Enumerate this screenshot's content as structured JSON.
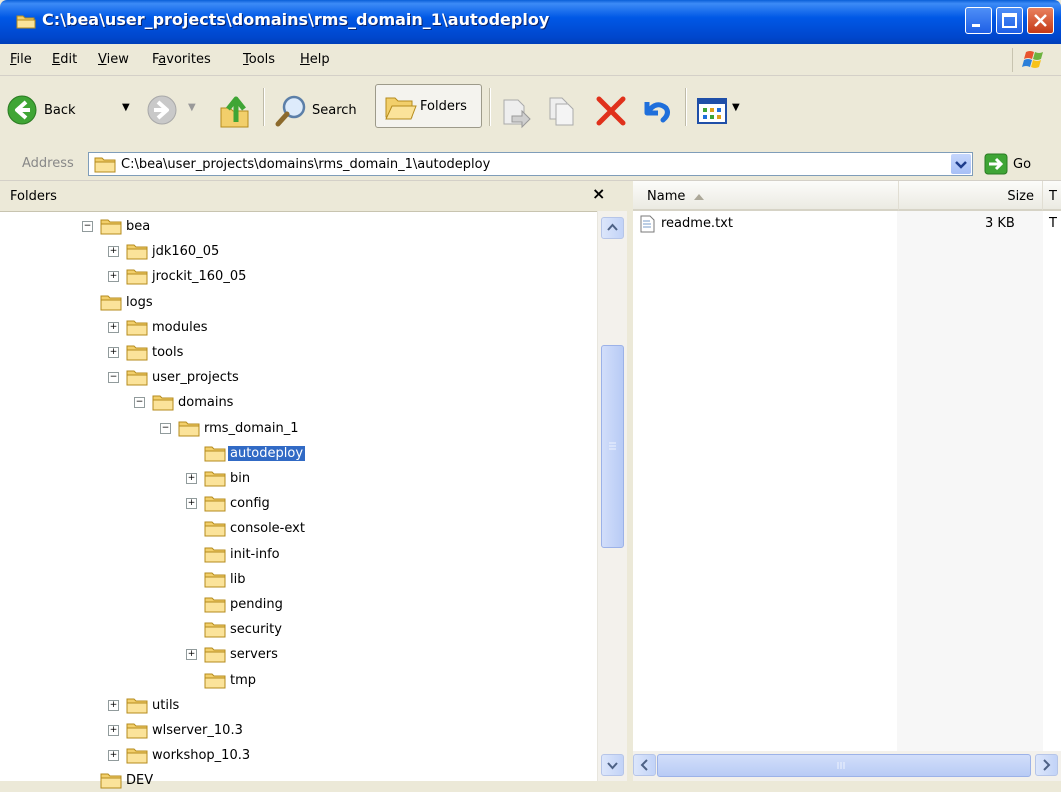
{
  "window": {
    "title": "C:\\bea\\user_projects\\domains\\rms_domain_1\\autodeploy"
  },
  "menu": {
    "file": "ile",
    "file_ul": "F",
    "edit": "dit",
    "edit_ul": "E",
    "view": "iew",
    "view_ul": "V",
    "favorites_pre": "F",
    "favorites_ul": "a",
    "favorites_post": "vorites",
    "tools": "ools",
    "tools_ul": "T",
    "help": "elp",
    "help_ul": "H"
  },
  "toolbar": {
    "back": "Back",
    "search": "Search",
    "folders": "Folders"
  },
  "address": {
    "label": "Address",
    "value": "C:\\bea\\user_projects\\domains\\rms_domain_1\\autodeploy",
    "go": "Go"
  },
  "folders_pane": {
    "title": "Folders",
    "close": "×",
    "tree": [
      {
        "label": "bea",
        "expander": "minus"
      },
      {
        "label": "jdk160_05",
        "expander": "plus"
      },
      {
        "label": "jrockit_160_05",
        "expander": "plus"
      },
      {
        "label": "logs",
        "expander": "none"
      },
      {
        "label": "modules",
        "expander": "plus"
      },
      {
        "label": "tools",
        "expander": "plus"
      },
      {
        "label": "user_projects",
        "expander": "minus"
      },
      {
        "label": "domains",
        "expander": "minus"
      },
      {
        "label": "rms_domain_1",
        "expander": "minus"
      },
      {
        "label": "autodeploy",
        "expander": "none",
        "selected": true
      },
      {
        "label": "bin",
        "expander": "plus"
      },
      {
        "label": "config",
        "expander": "plus"
      },
      {
        "label": "console-ext",
        "expander": "none"
      },
      {
        "label": "init-info",
        "expander": "none"
      },
      {
        "label": "lib",
        "expander": "none"
      },
      {
        "label": "pending",
        "expander": "none"
      },
      {
        "label": "security",
        "expander": "none"
      },
      {
        "label": "servers",
        "expander": "plus"
      },
      {
        "label": "tmp",
        "expander": "none"
      },
      {
        "label": "utils",
        "expander": "plus"
      },
      {
        "label": "wlserver_10.3",
        "expander": "plus"
      },
      {
        "label": "workshop_10.3",
        "expander": "plus"
      },
      {
        "label": "DEV",
        "expander": "none"
      }
    ]
  },
  "file_list": {
    "columns": {
      "name": "Name",
      "size": "Size",
      "type_partial": "T"
    },
    "files": [
      {
        "name": "readme.txt",
        "size": "3 KB",
        "type_partial": "T"
      }
    ]
  },
  "colors": {
    "selection": "#316AC5",
    "titlebar": "#0058E6"
  }
}
